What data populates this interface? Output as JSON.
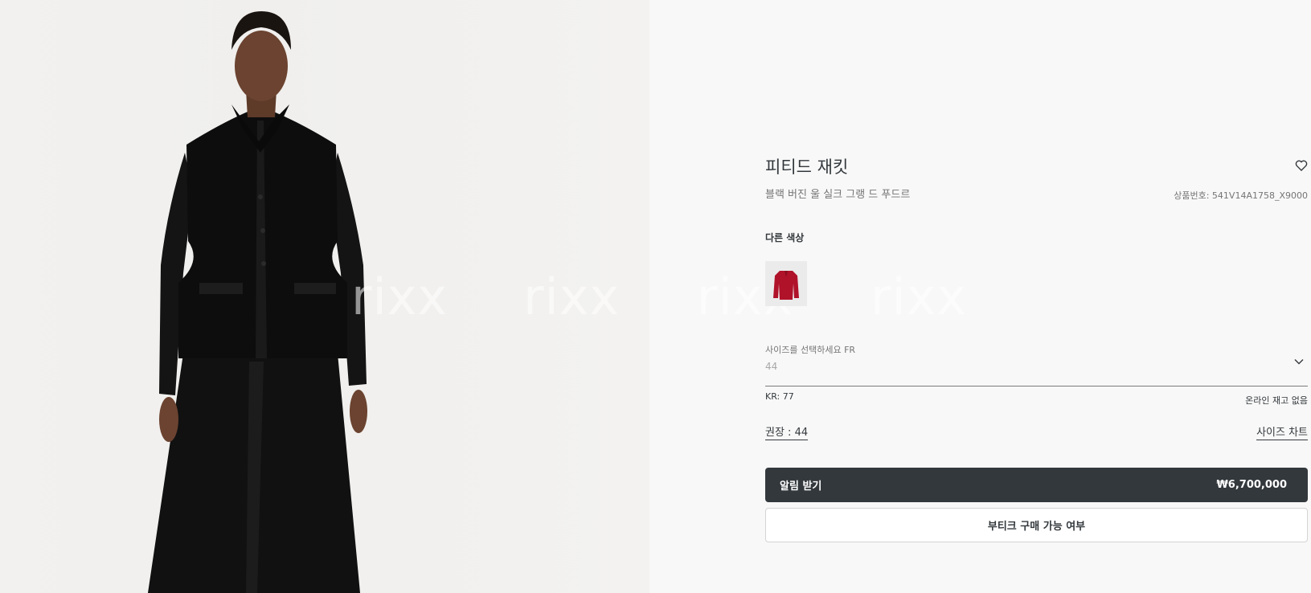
{
  "product": {
    "title": "피티드 재킷",
    "subtitle": "블랙 버진 울 실크 그랭 드 푸드르",
    "sku": "상품번호: 541V14A1758_X9000"
  },
  "colors": {
    "label": "다른 색상",
    "swatch_color": "#b0122a"
  },
  "size": {
    "label": "사이즈를 선택하세요 FR",
    "value": "44",
    "kr": "KR: 77",
    "stock_status": "온라인 재고 없음",
    "recommended": "권장 : 44",
    "chart_link": "사이즈 차트"
  },
  "actions": {
    "notify_label": "알림 받기",
    "price": "₩6,700,000",
    "boutique_label": "부티크 구매 가능 여부"
  },
  "watermark": [
    "rixx",
    "rixx",
    "rixx",
    "rixx"
  ],
  "icons": {
    "wishlist": "heart-icon",
    "dropdown": "chevron-down-icon"
  },
  "theme": {
    "accent": "#33383c",
    "background": "#f8f8f8"
  }
}
